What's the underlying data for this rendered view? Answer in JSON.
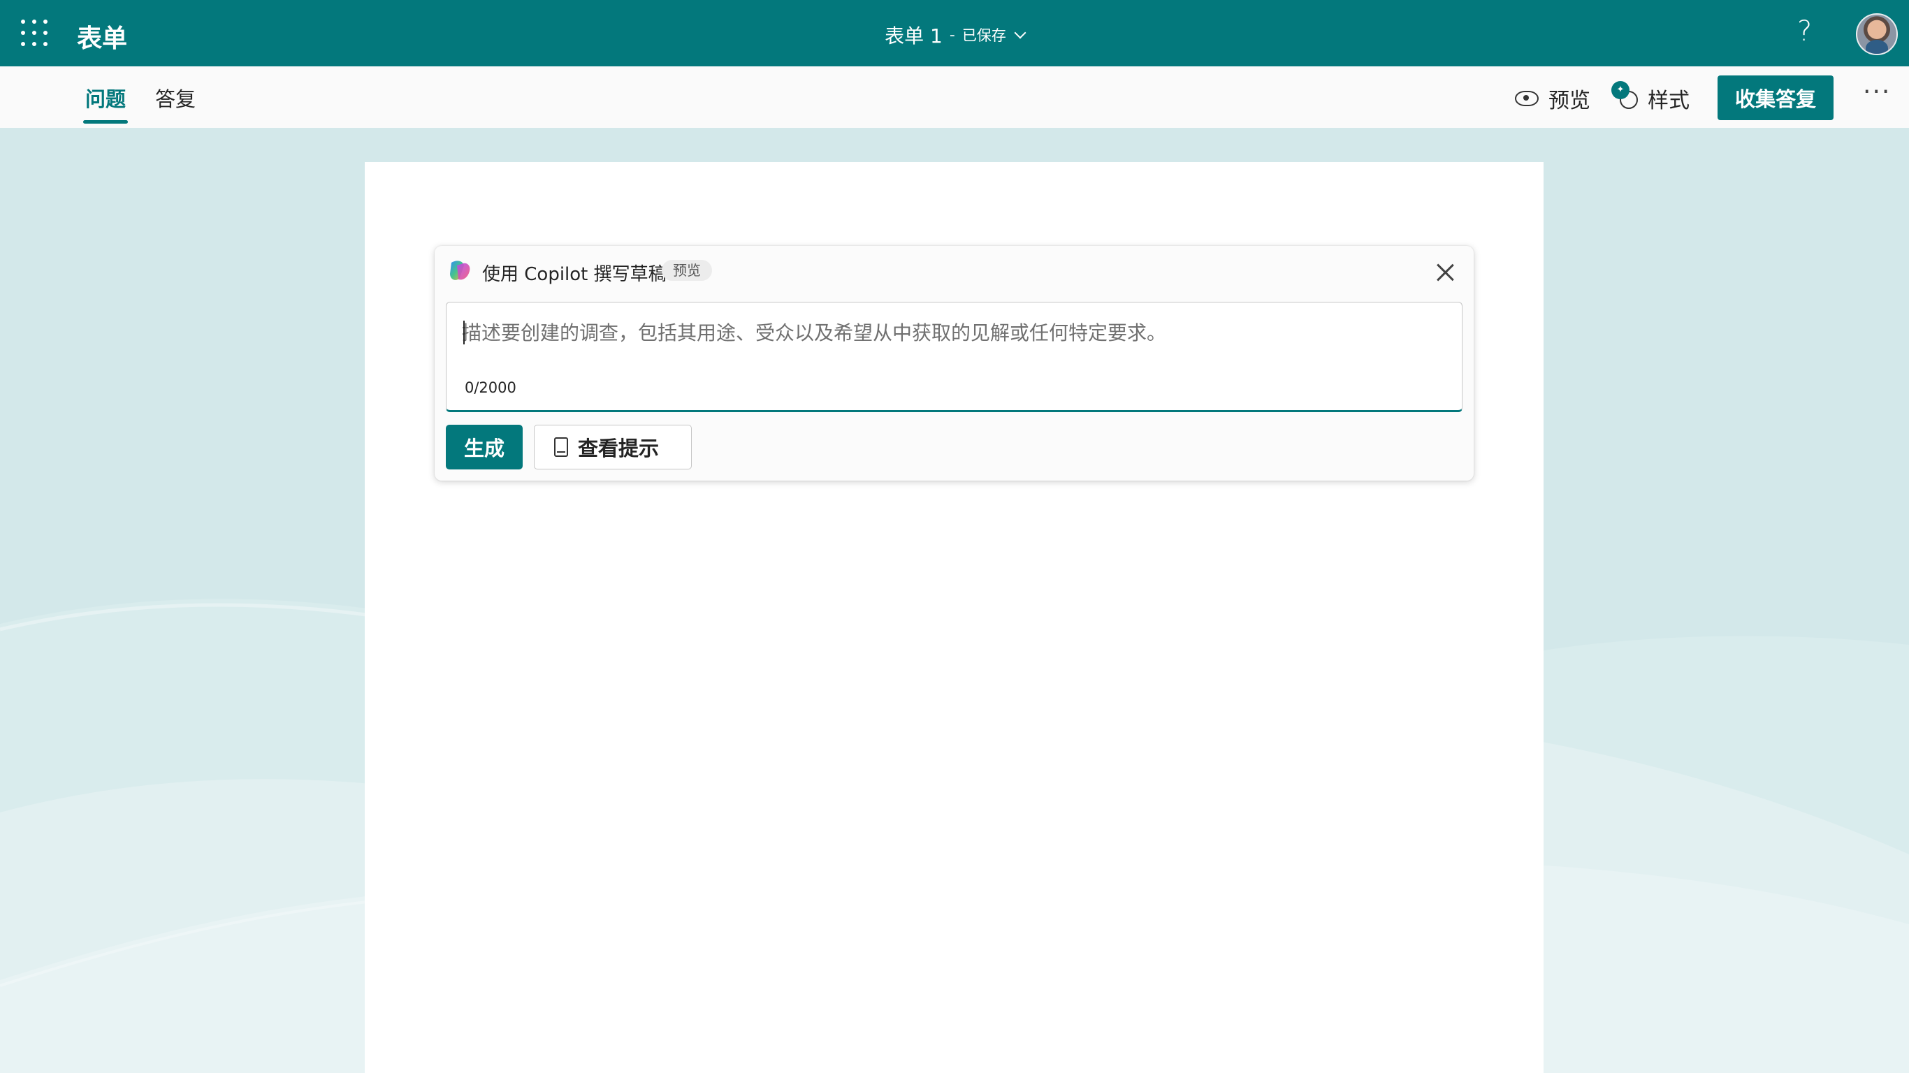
{
  "header": {
    "app_name": "表单",
    "doc_title": "表单 1",
    "separator": "-",
    "save_status": "已保存",
    "help_label": "?"
  },
  "commandbar": {
    "tabs": [
      {
        "label": "问题",
        "active": true
      },
      {
        "label": "答复",
        "active": false
      }
    ],
    "preview_label": "预览",
    "style_label": "样式",
    "collect_label": "收集答复",
    "more_label": "···"
  },
  "copilot": {
    "title": "使用 Copilot 撰写草稿",
    "badge": "预览",
    "input_value": "",
    "input_placeholder": "描述要创建的调查，包括其用途、受众以及希望从中获取的见解或任何特定要求。",
    "char_count": "0/2000",
    "generate_label": "生成",
    "tips_label": "查看提示"
  },
  "colors": {
    "accent": "#03787c",
    "background": "#d3e8ea"
  },
  "icons": {
    "waffle": "app-launcher-icon",
    "preview": "eye-icon",
    "style": "palette-icon",
    "close": "close-icon",
    "tips": "book-icon",
    "copilot": "copilot-logo-icon"
  }
}
